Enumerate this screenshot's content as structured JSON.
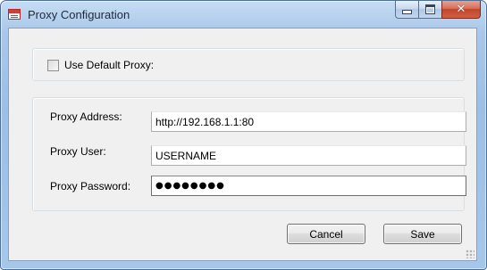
{
  "window": {
    "title": "Proxy Configuration",
    "icon": "app-window-icon",
    "caption_buttons": [
      "minimize-icon",
      "maximize-icon",
      "close-icon"
    ]
  },
  "default_proxy": {
    "label": "Use Default Proxy:",
    "checked": false
  },
  "proxy": {
    "address_label": "Proxy Address:",
    "address_value": "http://192.168.1.1:80",
    "user_label": "Proxy User:",
    "user_value": "USERNAME",
    "password_label": "Proxy Password:",
    "password_value": "●●●●●●●●"
  },
  "buttons": {
    "cancel_label": "Cancel",
    "save_label": "Save"
  },
  "colors": {
    "frame": "#a9c7ea",
    "client": "#f0f0f0",
    "close_button": "#c2442a",
    "focus_border": "#3d7bad"
  }
}
